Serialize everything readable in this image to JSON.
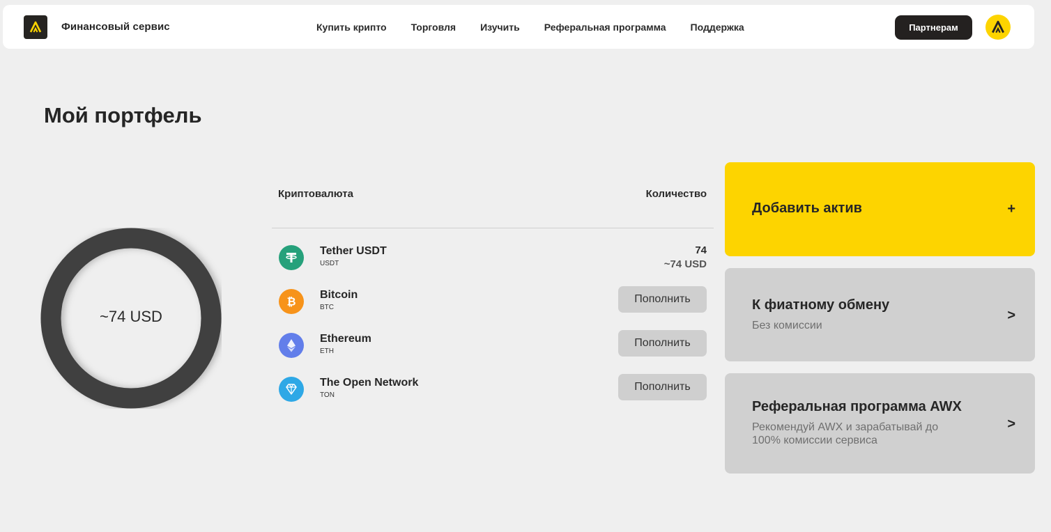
{
  "header": {
    "brand": "Финансовый сервис",
    "nav": [
      "Купить крипто",
      "Торговля",
      "Изучить",
      "Реферальная программа",
      "Поддержка"
    ],
    "partner_button": "Партнерам"
  },
  "page": {
    "title": "Мой портфель"
  },
  "portfolio": {
    "total": "~74 USD",
    "filled_fraction": 1.0
  },
  "table": {
    "col_crypto": "Криптовалюта",
    "col_amount": "Количество",
    "rows": [
      {
        "name": "Tether USDT",
        "ticker": "USDT",
        "amount": "74",
        "amount_usd": "~74 USD",
        "action": ""
      },
      {
        "name": "Bitcoin",
        "ticker": "BTC",
        "amount": "",
        "amount_usd": "",
        "action": "Пополнить"
      },
      {
        "name": "Ethereum",
        "ticker": "ETH",
        "amount": "",
        "amount_usd": "",
        "action": "Пополнить"
      },
      {
        "name": "The Open Network",
        "ticker": "TON",
        "amount": "",
        "amount_usd": "",
        "action": "Пополнить"
      }
    ]
  },
  "cards": {
    "add": {
      "title": "Добавить актив",
      "icon": "+"
    },
    "fiat": {
      "title": "К фиатному обмену",
      "subtitle": "Без комиссии",
      "icon": ">"
    },
    "referral": {
      "title": "Реферальная программа AWX",
      "subtitle": "Рекомендуй AWX и зарабатывай до 100% комиссии сервиса",
      "icon": ">"
    }
  },
  "colors": {
    "accent": "#fdd400",
    "dark": "#262421",
    "usdt": "#26a17b",
    "btc": "#f7931a",
    "eth": "#627eea",
    "ton": "#2ea8e6",
    "card_gray": "#d0d0d0",
    "donut": "#404040"
  },
  "icons": {
    "logo": "awx-logo-icon",
    "avatar": "awx-avatar-icon",
    "usdt": "tether-icon",
    "btc": "bitcoin-icon",
    "eth": "ethereum-icon",
    "ton": "ton-diamond-icon"
  }
}
